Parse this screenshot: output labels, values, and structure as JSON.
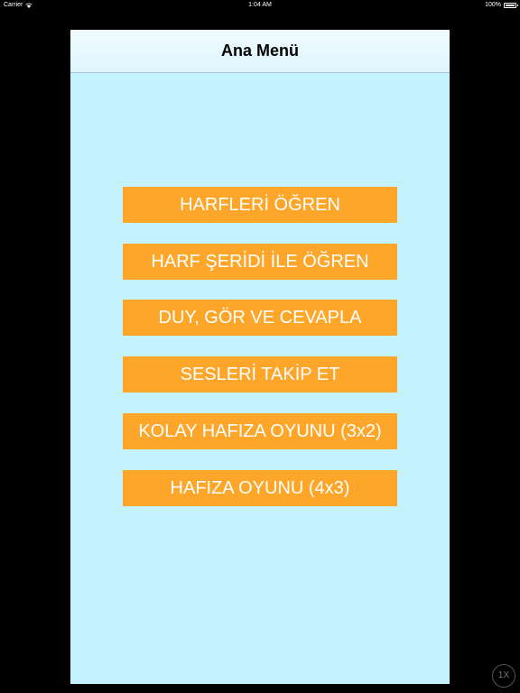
{
  "status_bar": {
    "carrier": "Carrier",
    "time": "1:04 AM",
    "battery": "100%"
  },
  "nav": {
    "title": "Ana Menü"
  },
  "menu": {
    "items": [
      {
        "label": "HARFLERİ ÖĞREN"
      },
      {
        "label": "HARF ŞERİDİ İLE ÖĞREN"
      },
      {
        "label": "DUY, GÖR VE CEVAPLA"
      },
      {
        "label": "SESLERİ TAKİP ET"
      },
      {
        "label": "KOLAY HAFIZA OYUNU (3x2)"
      },
      {
        "label": "HAFIZA OYUNU (4x3)"
      }
    ]
  },
  "zoom": {
    "label": "1X"
  },
  "colors": {
    "background": "#c4f2fe",
    "button": "#fea62a",
    "button_text": "#ffffff"
  }
}
